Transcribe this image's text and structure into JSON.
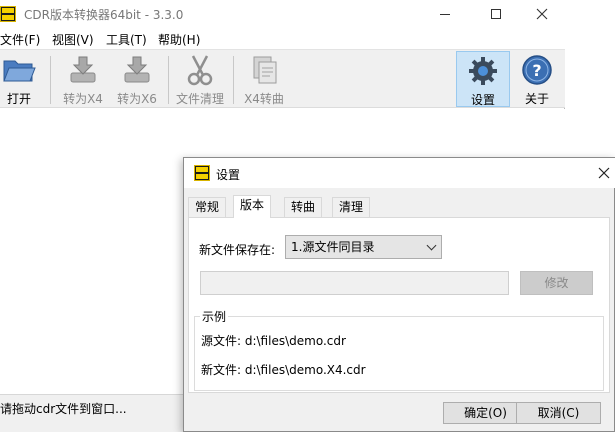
{
  "main": {
    "title": "CDR版本转换器64bit - 3.3.0",
    "menu": [
      "文件(F)",
      "视图(V)",
      "工具(T)",
      "帮助(H)"
    ],
    "toolbar": {
      "open": "打开",
      "to_x4": "转为X4",
      "to_x6": "转为X6",
      "clean": "文件清理",
      "x4_curve": "X4转曲",
      "settings": "设置",
      "about": "关于"
    },
    "status": "请拖动cdr文件到窗口..."
  },
  "dialog": {
    "title": "设置",
    "tabs": [
      "常规",
      "版本",
      "转曲",
      "清理"
    ],
    "selected_tab": "版本",
    "save_label": "新文件保存在:",
    "save_select_value": "1.源文件同目录",
    "modify_button": "修改",
    "example_group": "示例",
    "source_line": "源文件:  d:\\files\\demo.cdr",
    "new_line": "新文件:  d:\\files\\demo.X4.cdr",
    "ok_button": "确定(O)",
    "cancel_button": "取消(C)"
  },
  "colors": {
    "toolbar_bg": "#f0f0f0",
    "active_tool_bg": "#cce4f7",
    "icon_blue": "#3b6fb3",
    "icon_gray": "#9a9a9a"
  }
}
